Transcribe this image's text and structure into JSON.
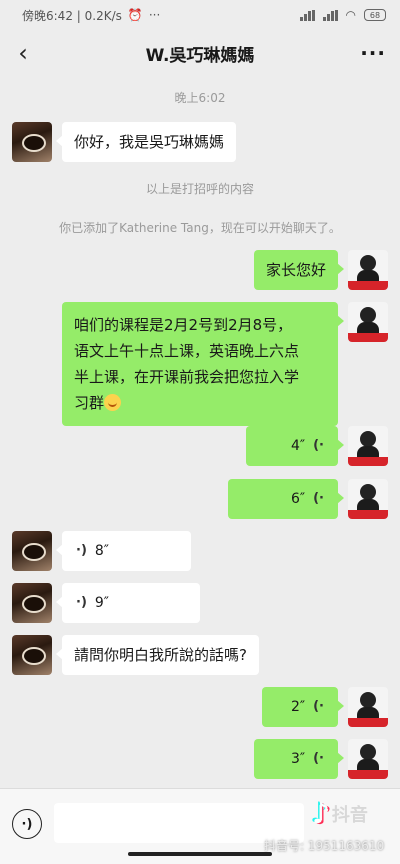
{
  "status": {
    "time": "傍晚6:42 | 0.2K/s",
    "battery": "68"
  },
  "header": {
    "back_icon": "chevron-left-icon",
    "title": "W.吳巧琳媽媽",
    "more_label": "···"
  },
  "chat": {
    "timestamp": "晚上6:02",
    "greeting_text": "你好，我是吳巧琳媽媽",
    "system_greeting": "以上是打招呼的内容",
    "system_added": "你已添加了Katherine Tang，现在可以开始聊天了。",
    "msg_hello": "家长您好",
    "msg_course_line1": "咱们的课程是2月2号到2月8号，",
    "msg_course_line2": "语文上午十点上课，英语晚上六点",
    "msg_course_line3": "半上课，在开课前我会把您拉入学",
    "msg_course_line4": "习群",
    "voice_out_1": "4″",
    "voice_out_2": "6″",
    "voice_in_1": "8″",
    "voice_in_2": "9″",
    "msg_question": "請問你明白我所說的話嗎?",
    "voice_out_3": "2″",
    "voice_out_4": "3″"
  },
  "footer": {
    "tiktok_brand": "抖音",
    "tiktok_id": "抖音号: 1951163610"
  }
}
